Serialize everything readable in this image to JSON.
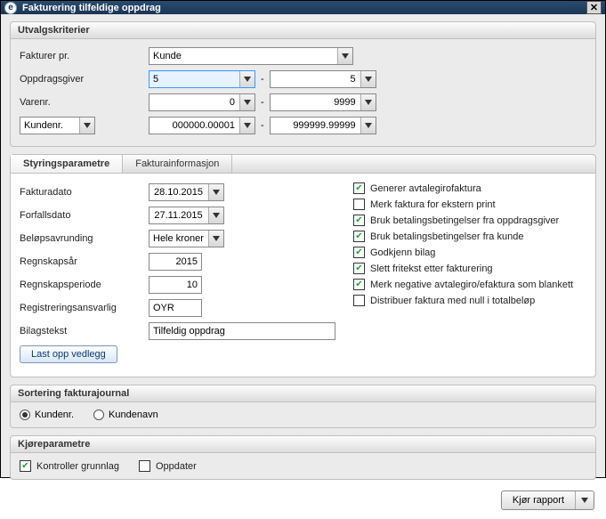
{
  "titlebar": {
    "title": "Fakturering tilfeldige oppdrag"
  },
  "selection": {
    "header": "Utvalgskriterier",
    "row1_label": "Fakturer pr.",
    "row1_value": "Kunde",
    "row2_label": "Oppdragsgiver",
    "row2_from": "5",
    "row2_to": "5",
    "row3_label": "Varenr.",
    "row3_from": "0",
    "row3_to": "9999",
    "row4_selector": "Kundenr.",
    "row4_from": "000000.00001",
    "row4_to": "999999.99999"
  },
  "tabs": {
    "tab1": "Styringsparametre",
    "tab2": "Fakturainformasjon"
  },
  "params": {
    "fakturadato_label": "Fakturadato",
    "fakturadato": "28.10.2015",
    "forfallsdato_label": "Forfallsdato",
    "forfallsdato": "27.11.2015",
    "belop_label": "Beløpsavrunding",
    "belop_value": "Hele kroner",
    "regnskapsar_label": "Regnskapsår",
    "regnskapsar": "2015",
    "periode_label": "Regnskapsperiode",
    "periode": "10",
    "ansvarlig_label": "Registreringsansvarlig",
    "ansvarlig": "OYR",
    "bilagstekst_label": "Bilagstekst",
    "bilagstekst": "Tilfeldig oppdrag",
    "upload_btn": "Last opp vedlegg"
  },
  "checks": {
    "c1": "Generer avtalegirofaktura",
    "c2": "Merk faktura for ekstern print",
    "c3": "Bruk betalingsbetingelser fra oppdragsgiver",
    "c4": "Bruk betalingsbetingelser fra kunde",
    "c5": "Godkjenn bilag",
    "c6": "Slett fritekst etter fakturering",
    "c7": "Merk negative avtalegiro/efaktura som blankett",
    "c8": "Distribuer faktura med null i totalbeløp"
  },
  "sort": {
    "header": "Sortering fakturajournal",
    "opt1": "Kundenr.",
    "opt2": "Kundenavn"
  },
  "run": {
    "header": "Kjøreparametre",
    "chk1": "Kontroller grunnlag",
    "chk2": "Oppdater"
  },
  "footer": {
    "run_btn": "Kjør rapport"
  }
}
